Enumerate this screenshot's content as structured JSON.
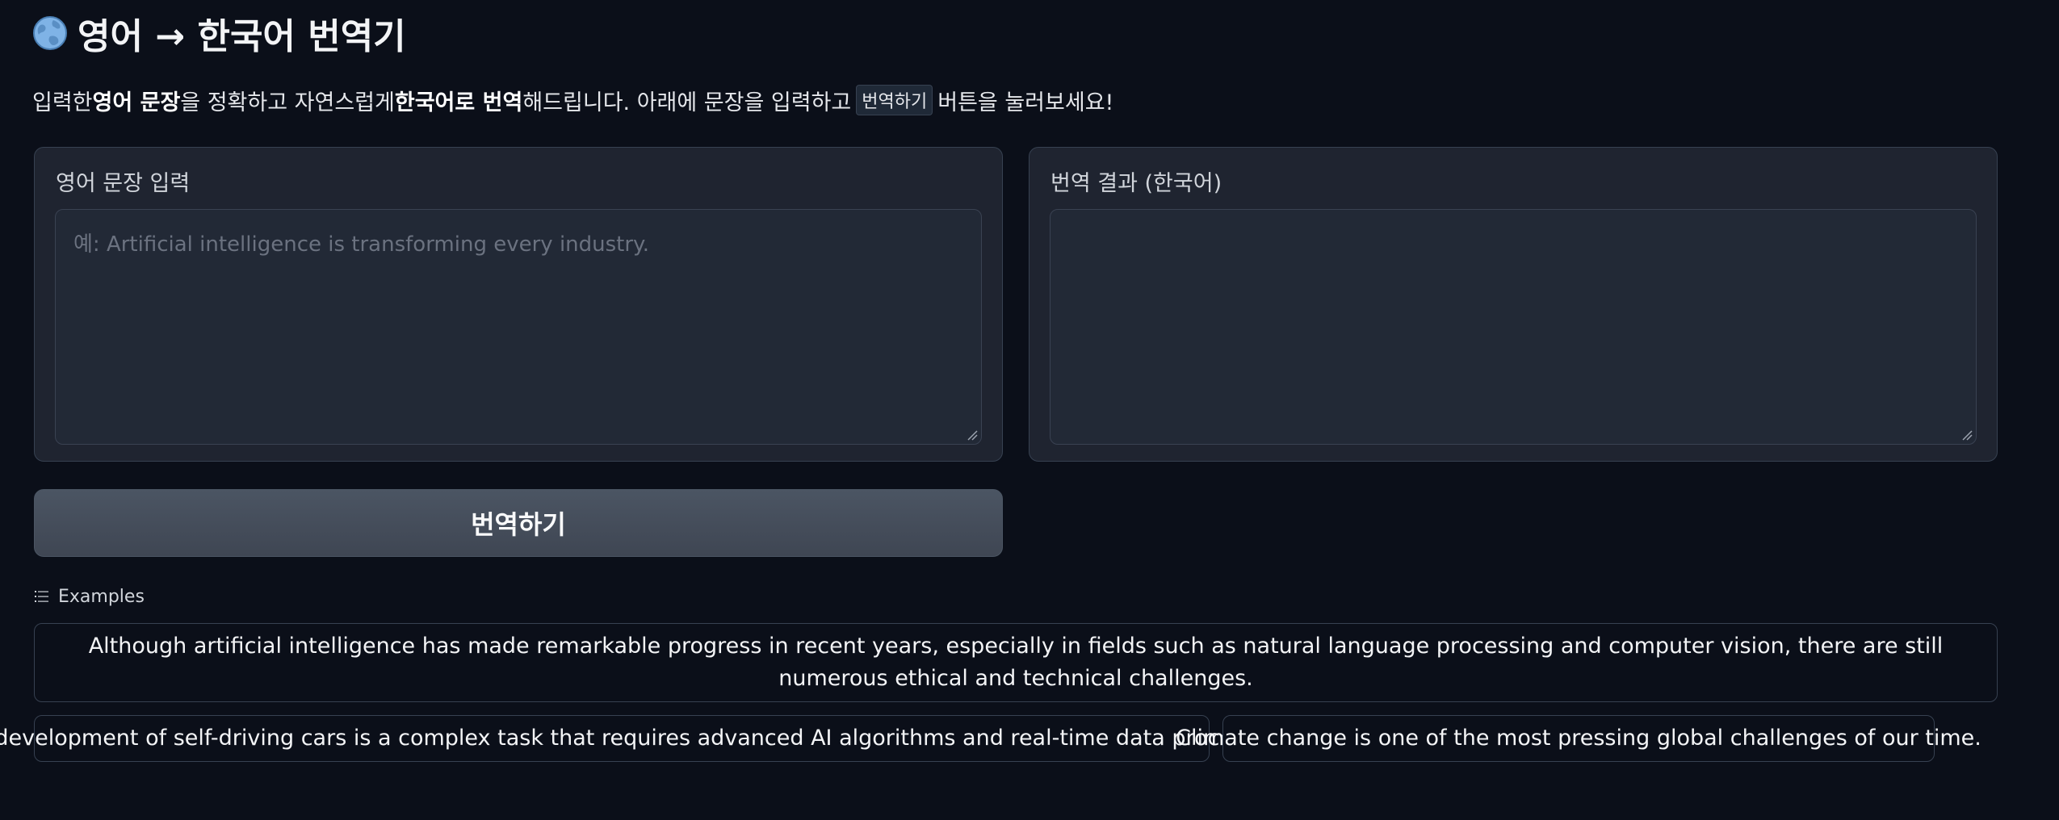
{
  "header": {
    "globe_icon": "globe-icon",
    "title": "영어 → 한국어 번역기"
  },
  "description": {
    "part1": "입력한 ",
    "bold1": "영어 문장",
    "part2": "을 정확하고 자연스럽게 ",
    "bold2": "한국어로 번역",
    "part3": "해드립니다. 아래에 문장을 입력하고 ",
    "code": "번역하기",
    "part4": " 버튼을 눌러보세요!"
  },
  "input_panel": {
    "label": "영어 문장 입력",
    "value": "",
    "placeholder": "예: Artificial intelligence is transforming every industry."
  },
  "output_panel": {
    "label": "번역 결과 (한국어)",
    "value": ""
  },
  "translate_button": {
    "label": "번역하기"
  },
  "examples": {
    "label": "Examples",
    "items": [
      "Although artificial intelligence has made remarkable progress in recent years, especially in fields such as natural language processing and computer vision, there are still numerous ethical and technical challenges.",
      "The development of self-driving cars is a complex task that requires advanced AI algorithms and real-time data processing.",
      "Climate change is one of the most pressing global challenges of our time."
    ]
  },
  "colors": {
    "background": "#0b0f19",
    "panel": "#1f2430",
    "border": "#374151",
    "button": "#4b5563"
  }
}
